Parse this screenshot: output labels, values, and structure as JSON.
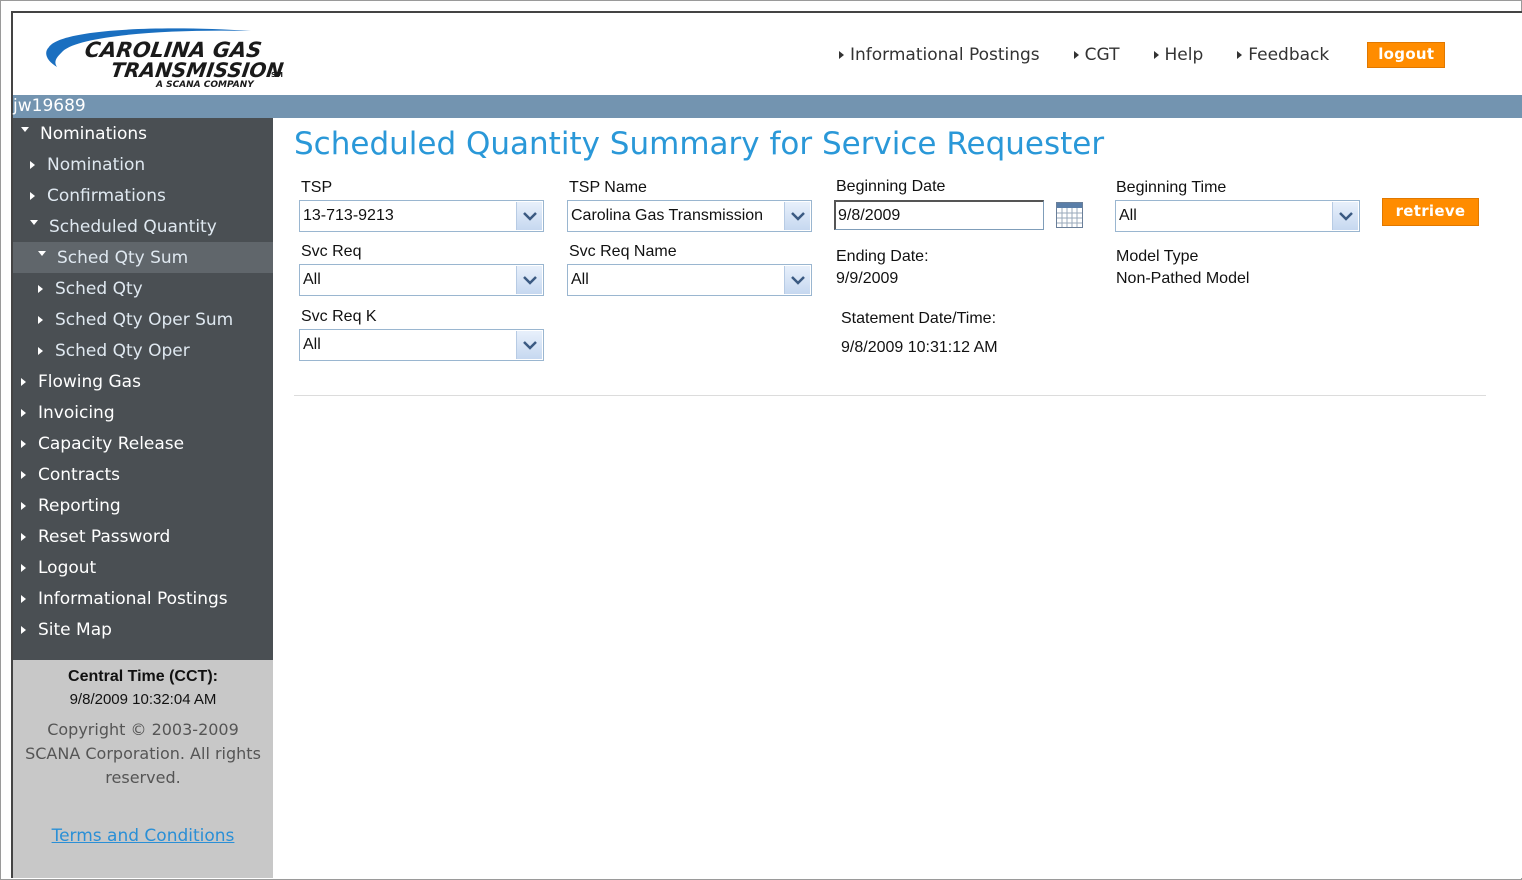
{
  "logo": {
    "line1": "CAROLINA GAS",
    "line2": "TRANSMISSION",
    "line3": "A SCANA COMPANY",
    "mark": "SM"
  },
  "topnav": {
    "links": [
      "Informational Postings",
      "CGT",
      "Help",
      "Feedback"
    ],
    "logout_label": "logout"
  },
  "user": {
    "name": "jw19689"
  },
  "sidebar": {
    "items": [
      {
        "label": "Nominations",
        "state": "expanded",
        "level": 0
      },
      {
        "label": "Nomination",
        "state": "collapsed",
        "level": 1
      },
      {
        "label": "Confirmations",
        "state": "collapsed",
        "level": 1
      },
      {
        "label": "Scheduled Quantity",
        "state": "expanded",
        "level": 1
      },
      {
        "label": "Sched Qty Sum",
        "state": "expanded",
        "level": 2,
        "active": true
      },
      {
        "label": "Sched Qty",
        "state": "collapsed",
        "level": 2
      },
      {
        "label": "Sched Qty Oper Sum",
        "state": "collapsed",
        "level": 2
      },
      {
        "label": "Sched Qty Oper",
        "state": "collapsed",
        "level": 2
      },
      {
        "label": "Flowing Gas",
        "state": "collapsed",
        "level": 0
      },
      {
        "label": "Invoicing",
        "state": "collapsed",
        "level": 0
      },
      {
        "label": "Capacity Release",
        "state": "collapsed",
        "level": 0
      },
      {
        "label": "Contracts",
        "state": "collapsed",
        "level": 0
      },
      {
        "label": "Reporting",
        "state": "collapsed",
        "level": 0
      },
      {
        "label": "Reset Password",
        "state": "collapsed",
        "level": 0
      },
      {
        "label": "Logout",
        "state": "collapsed",
        "level": 0
      },
      {
        "label": "Informational Postings",
        "state": "collapsed",
        "level": 0
      },
      {
        "label": "Site Map",
        "state": "collapsed",
        "level": 0
      }
    ],
    "footer": {
      "cct_label": "Central Time (CCT):",
      "cct_time": "9/8/2009 10:32:04 AM",
      "copyright": "Copyright © 2003-2009 SCANA Corporation. All rights reserved.",
      "terms": "Terms and Conditions"
    }
  },
  "main": {
    "title": "Scheduled Quantity Summary for Service Requester",
    "fields": {
      "tsp": {
        "label": "TSP",
        "value": "13-713-9213"
      },
      "tsp_name": {
        "label": "TSP Name",
        "value": "Carolina Gas Transmission"
      },
      "beginning_date": {
        "label": "Beginning Date",
        "value": "9/8/2009"
      },
      "beginning_time": {
        "label": "Beginning Time",
        "value": "All"
      },
      "svc_req": {
        "label": "Svc Req",
        "value": "All"
      },
      "svc_req_name": {
        "label": "Svc Req Name",
        "value": "All"
      },
      "ending_date": {
        "label": "Ending Date:",
        "value": "9/9/2009"
      },
      "model_type": {
        "label": "Model Type",
        "value": "Non-Pathed Model"
      },
      "svc_req_k": {
        "label": "Svc Req K",
        "value": "All"
      },
      "statement": {
        "label": "Statement Date/Time:",
        "value": "9/8/2009 10:31:12 AM"
      }
    },
    "retrieve_label": "retrieve"
  },
  "colors": {
    "accent_orange": "#ff8c00",
    "title_blue": "#2a98d8",
    "userbar": "#7394b0",
    "sidebar_bg": "#4a4f53",
    "sidebar_footer_bg": "#c8c8c8"
  }
}
